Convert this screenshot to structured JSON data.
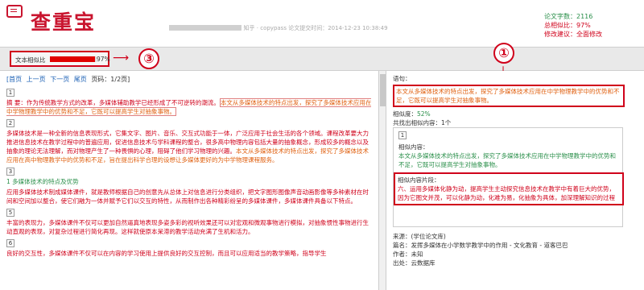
{
  "header": {
    "logo_text": "查重宝",
    "meta_text": "知乎 · copypass  论文提交时间：2014-12-23 10:38:49",
    "stats": [
      {
        "label": "论文字数：",
        "value": "2116"
      },
      {
        "label": "总相似比：",
        "value": "97%"
      },
      {
        "label": "修改建议：",
        "value": "全面修改"
      }
    ]
  },
  "toolbar": {
    "rate_label": "文本相似比",
    "rate_value": "97%",
    "rate_fraction": 0.97
  },
  "badges": [
    "①",
    "②",
    "③"
  ],
  "pager": {
    "first": "[首页",
    "prev": "上一页",
    "next": "下一页",
    "last": "尾页",
    "page": "页码：1/2页]"
  },
  "left": {
    "seg1": "1",
    "abstract_red": "摘 要：作为传统教学方式的改革，多媒体辅助教学已经形成了不可逆转的潮流。",
    "abstract_orange": "本文从多媒体技术的特点出发，探究了多媒体技术应用在中学物理教学中的优势和不足，它既可以提高学生对抽象事物。",
    "seg2": "2",
    "p2_red": "多媒体技术是一种全新的信息表现形式，它集文字、图片、音乐、交互式功能于一体，广泛应用于社会生活的各个领域。课程改革要大力推进信息技术在教学过程中的普遍应用，促进信息技术与学科课程的整合，",
    "p2_red2": "很多高中物理内容包括大量的抽象概念，形成较多的概念以及抽象的理论无法理解，而对物理产生了一种畏惧的心理，阻碍了他们学习物理的兴趣。",
    "p2_orange": "本文从多媒体技术的特点出发，探究了多媒体技术应用在高中物理教学中的优势和不足，旨在提出科学合理的设想让多媒体更好的为中学物理课程服务。",
    "seg3": "3",
    "h3": "1 多媒体技术的特点及优势",
    "p3_red": "应用多媒体技术制成媒体课件，就是教师根据自己的创意先从总体上对信息进行分类组织，把文字图形图像声音动画影像等多种素材在时间和空间加以整合，使它们融为一体并赋予它们以交互的特性，从而制作出各种精彩纷呈的多媒体课件，多媒体课件具备以下特点。",
    "seg5": "5",
    "p5_red": "丰富的表现力，多媒体课件不仅可以更加自然逼真地表现多姿多彩的视听效果还可以对宏观和微观事物进行模拟，对抽象惯性事物进行生动直观的表现，对复杂过程进行简化再现。这样就使原本呆滞的教学活动充满了生机和活力。",
    "seg6": "6",
    "p6_red": "良好的交互性，多媒体课件不仅可以在内容的学习使用上提供良好的交互控制，而且可以应用适当的教学策略，指导学生"
  },
  "right": {
    "sentence_label": "语句：",
    "sentence_text": "本文从多媒体技术的特点出发，探究了多媒体技术应用在中学物理教学中的优势和不足，它既可以提高学生对抽象事物。",
    "sim_label": "相似度：",
    "sim_value": "52%",
    "found_label": "共找出相似内容：1个",
    "card_seg": "1",
    "content_label": "相似内容：",
    "content_text": "本文从多媒体技术的特点出发，探究了多媒体技术应用在中学物理教学中的优势和不足，它既可以提高学生对抽象事物。",
    "frag_label": "相似内容片段：",
    "frag_text": "六、运用多媒体化静为动，提高学生主动探究信息技术在教学中有着巨大的优势，因为它图文并茂，可以化静为动，化难为易，化抽象为具体，加深理解知识的过程",
    "source_label": "来源：(学位论文库)",
    "src_title": "篇名：发挥多媒体在小学数学教学中的作用 - 文化教育 - 道客巴巴",
    "src_author": "作者：未知",
    "src_from": "出处：云数据库"
  }
}
